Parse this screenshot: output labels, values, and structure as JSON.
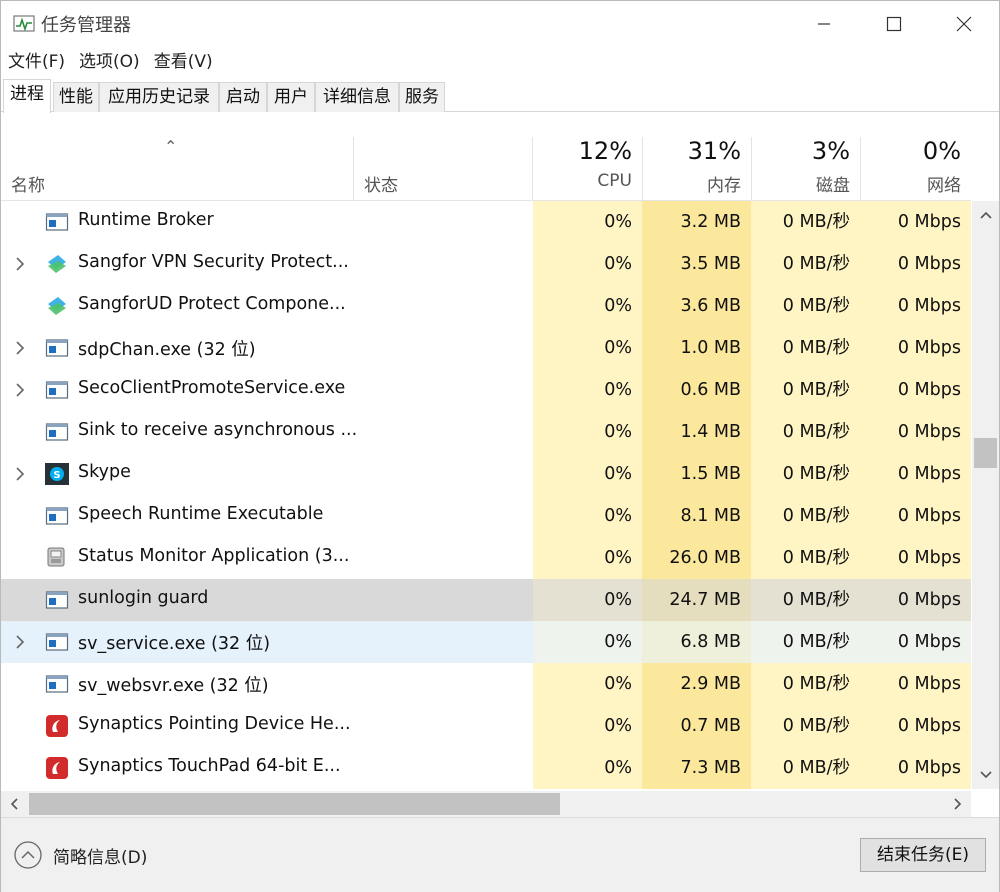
{
  "window": {
    "title": "任务管理器"
  },
  "menu": [
    "文件(F)",
    "选项(O)",
    "查看(V)"
  ],
  "tabs": [
    "进程",
    "性能",
    "应用历史记录",
    "启动",
    "用户",
    "详细信息",
    "服务"
  ],
  "columns": {
    "name": "名称",
    "status": "状态",
    "cpu": {
      "percent": "12%",
      "label": "CPU"
    },
    "memory": {
      "percent": "31%",
      "label": "内存"
    },
    "disk": {
      "percent": "3%",
      "label": "磁盘"
    },
    "network": {
      "percent": "0%",
      "label": "网络"
    }
  },
  "processes": [
    {
      "name": "Runtime Broker",
      "icon": "generic-app-icon",
      "expandable": false,
      "cpu": "0%",
      "memory": "3.2 MB",
      "disk": "0 MB/秒",
      "network": "0 Mbps",
      "state": "normal"
    },
    {
      "name": "Sangfor VPN Security Protect...",
      "icon": "sangfor-icon",
      "expandable": true,
      "cpu": "0%",
      "memory": "3.5 MB",
      "disk": "0 MB/秒",
      "network": "0 Mbps",
      "state": "normal"
    },
    {
      "name": "SangforUD Protect Compone...",
      "icon": "sangfor-icon",
      "expandable": false,
      "cpu": "0%",
      "memory": "3.6 MB",
      "disk": "0 MB/秒",
      "network": "0 Mbps",
      "state": "normal"
    },
    {
      "name": "sdpChan.exe (32 位)",
      "icon": "generic-app-icon",
      "expandable": true,
      "cpu": "0%",
      "memory": "1.0 MB",
      "disk": "0 MB/秒",
      "network": "0 Mbps",
      "state": "normal"
    },
    {
      "name": "SecoClientPromoteService.exe",
      "icon": "generic-app-icon",
      "expandable": true,
      "cpu": "0%",
      "memory": "0.6 MB",
      "disk": "0 MB/秒",
      "network": "0 Mbps",
      "state": "normal"
    },
    {
      "name": "Sink to receive asynchronous ...",
      "icon": "generic-app-icon",
      "expandable": false,
      "cpu": "0%",
      "memory": "1.4 MB",
      "disk": "0 MB/秒",
      "network": "0 Mbps",
      "state": "normal"
    },
    {
      "name": "Skype",
      "icon": "skype-icon",
      "expandable": true,
      "cpu": "0%",
      "memory": "1.5 MB",
      "disk": "0 MB/秒",
      "network": "0 Mbps",
      "state": "normal"
    },
    {
      "name": "Speech Runtime Executable",
      "icon": "generic-app-icon",
      "expandable": false,
      "cpu": "0%",
      "memory": "8.1 MB",
      "disk": "0 MB/秒",
      "network": "0 Mbps",
      "state": "normal"
    },
    {
      "name": "Status Monitor Application (3...",
      "icon": "status-monitor-icon",
      "expandable": false,
      "cpu": "0%",
      "memory": "26.0 MB",
      "disk": "0 MB/秒",
      "network": "0 Mbps",
      "state": "normal"
    },
    {
      "name": "sunlogin guard",
      "icon": "generic-app-icon",
      "expandable": false,
      "cpu": "0%",
      "memory": "24.7 MB",
      "disk": "0 MB/秒",
      "network": "0 Mbps",
      "state": "selected"
    },
    {
      "name": "sv_service.exe (32 位)",
      "icon": "generic-app-icon",
      "expandable": true,
      "cpu": "0%",
      "memory": "6.8 MB",
      "disk": "0 MB/秒",
      "network": "0 Mbps",
      "state": "hover"
    },
    {
      "name": "sv_websvr.exe (32 位)",
      "icon": "generic-app-icon",
      "expandable": false,
      "cpu": "0%",
      "memory": "2.9 MB",
      "disk": "0 MB/秒",
      "network": "0 Mbps",
      "state": "normal"
    },
    {
      "name": "Synaptics Pointing Device He...",
      "icon": "synaptics-icon",
      "expandable": false,
      "cpu": "0%",
      "memory": "0.7 MB",
      "disk": "0 MB/秒",
      "network": "0 Mbps",
      "state": "normal"
    },
    {
      "name": "Synaptics TouchPad 64-bit E...",
      "icon": "synaptics-icon",
      "expandable": false,
      "cpu": "0%",
      "memory": "7.3 MB",
      "disk": "0 MB/秒",
      "network": "0 Mbps",
      "state": "normal"
    }
  ],
  "footer": {
    "fewer_details": "简略信息(D)",
    "end_task": "结束任务(E)"
  }
}
